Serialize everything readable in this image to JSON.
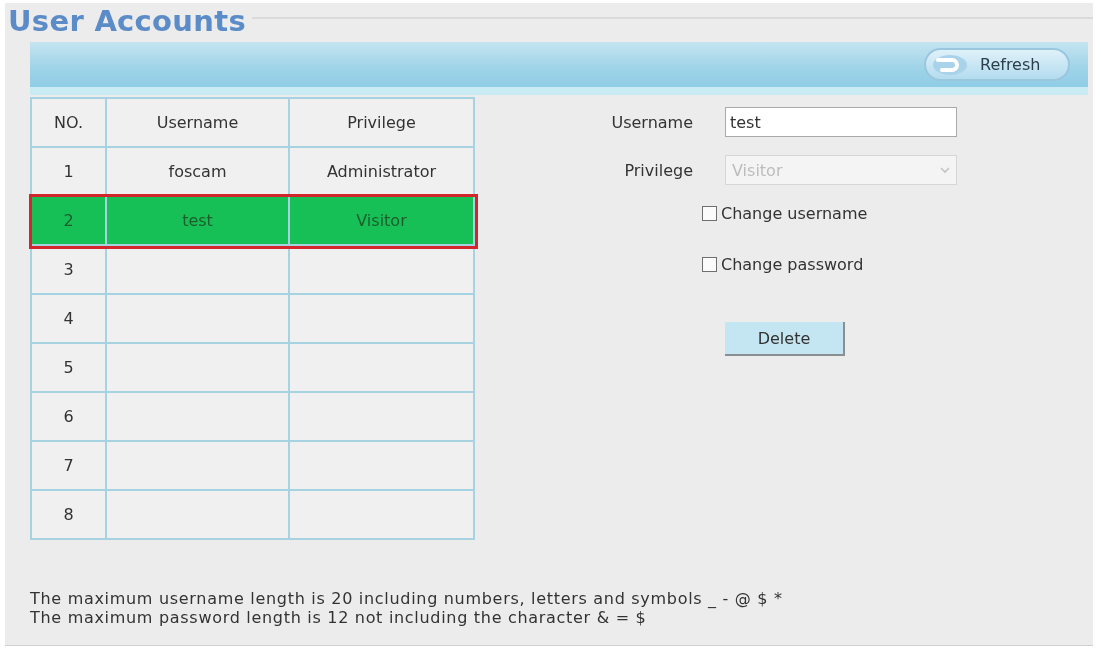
{
  "title": "User Accounts",
  "toolbar": {
    "refresh_button": "Refresh"
  },
  "table": {
    "columns": [
      "NO.",
      "Username",
      "Privilege"
    ],
    "rows": [
      {
        "no": "1",
        "username": "foscam",
        "privilege": "Administrator",
        "selected": false
      },
      {
        "no": "2",
        "username": "test",
        "privilege": "Visitor",
        "selected": true
      },
      {
        "no": "3",
        "selected": false
      },
      {
        "no": "4",
        "selected": false
      },
      {
        "no": "5",
        "selected": false
      },
      {
        "no": "6",
        "selected": false
      },
      {
        "no": "7",
        "selected": false
      },
      {
        "no": "8",
        "selected": false
      }
    ]
  },
  "form": {
    "fields": [
      {
        "kind": "text",
        "label": "Username",
        "value": "test",
        "disabled": false
      },
      {
        "kind": "select",
        "label": "Privilege",
        "value": "Visitor",
        "disabled": true
      }
    ],
    "checkboxes": [
      {
        "label": "Change username",
        "checked": false
      },
      {
        "label": "Change password",
        "checked": false
      }
    ],
    "delete_button": "Delete"
  },
  "notes": [
    "The maximum username length is 20 including numbers, letters and symbols _ - @ $ *",
    "The maximum password length is 12 not including the character & = $"
  ]
}
